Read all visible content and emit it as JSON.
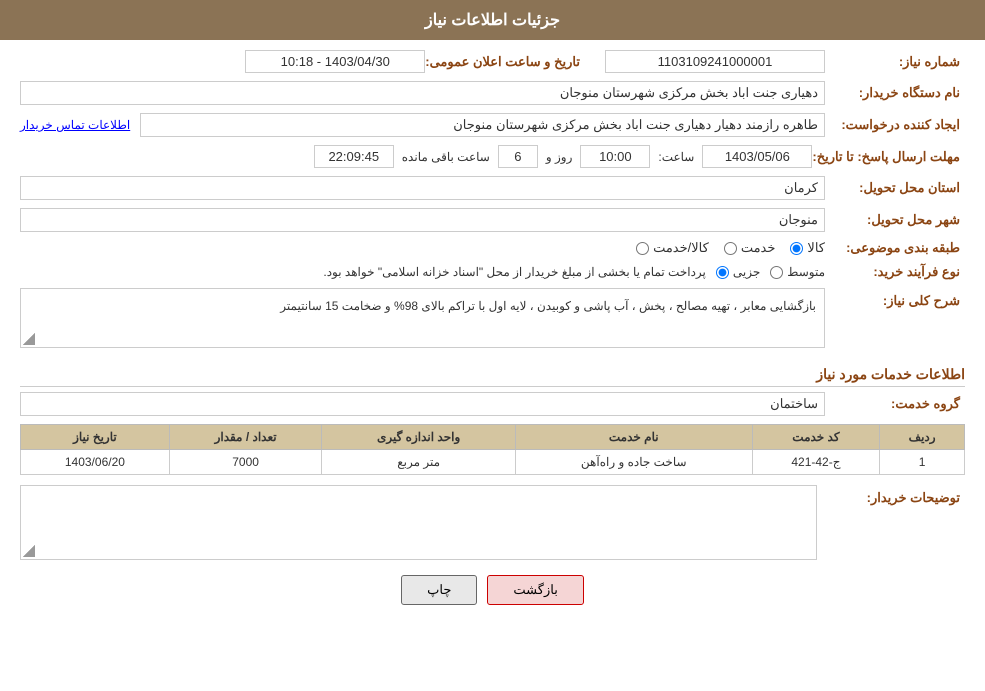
{
  "header": {
    "title": "جزئیات اطلاعات نیاز"
  },
  "fields": {
    "need_number_label": "شماره نیاز:",
    "need_number_value": "1103109241000001",
    "announcement_date_label": "تاریخ و ساعت اعلان عمومی:",
    "announcement_date_value": "1403/04/30 - 10:18",
    "buyer_org_label": "نام دستگاه خریدار:",
    "buyer_org_value": "دهیاری جنت اباد بخش مرکزی شهرستان منوجان",
    "requester_label": "ایجاد کننده درخواست:",
    "requester_value": "طاهره رازمند دهیار دهیاری جنت اباد بخش مرکزی شهرستان منوجان",
    "contact_info_label": "اطلاعات تماس خریدار",
    "response_deadline_label": "مهلت ارسال پاسخ: تا تاریخ:",
    "response_date": "1403/05/06",
    "response_time_label": "ساعت:",
    "response_time": "10:00",
    "response_days_label": "روز و",
    "response_days": "6",
    "response_remaining_label": "ساعت باقی مانده",
    "response_remaining": "22:09:45",
    "delivery_province_label": "استان محل تحویل:",
    "delivery_province_value": "کرمان",
    "delivery_city_label": "شهر محل تحویل:",
    "delivery_city_value": "منوجان",
    "category_label": "طبقه بندی موضوعی:",
    "category_options": [
      "کالا",
      "خدمت",
      "کالا/خدمت"
    ],
    "category_selected": "کالا",
    "process_label": "نوع فرآیند خرید:",
    "process_options": [
      "جزیی",
      "متوسط"
    ],
    "process_note": "پرداخت تمام یا بخشی از مبلغ خریدار از محل \"اسناد خزانه اسلامی\" خواهد بود.",
    "description_label": "شرح کلی نیاز:",
    "description_value": "بازگشایی معابر ، تهیه مصالح ، پخش ، آب پاشی و کوبیدن ، لایه اول با تراکم بالای 98% و ضخامت 15 سانتیمتر",
    "services_section_label": "اطلاعات خدمات مورد نیاز",
    "service_group_label": "گروه خدمت:",
    "service_group_value": "ساختمان",
    "table": {
      "headers": [
        "ردیف",
        "کد خدمت",
        "نام خدمت",
        "واحد اندازه گیری",
        "تعداد / مقدار",
        "تاریخ نیاز"
      ],
      "rows": [
        {
          "row": "1",
          "code": "ج-42-421",
          "name": "ساخت جاده و راه‌آهن",
          "unit": "متر مربع",
          "quantity": "7000",
          "date": "1403/06/20"
        }
      ]
    },
    "comments_label": "توضیحات خریدار:",
    "comments_value": ""
  },
  "buttons": {
    "print_label": "چاپ",
    "back_label": "بازگشت"
  },
  "colors": {
    "header_bg": "#8B7355",
    "label_color": "#8B4513",
    "table_header_bg": "#d4c5a0"
  }
}
